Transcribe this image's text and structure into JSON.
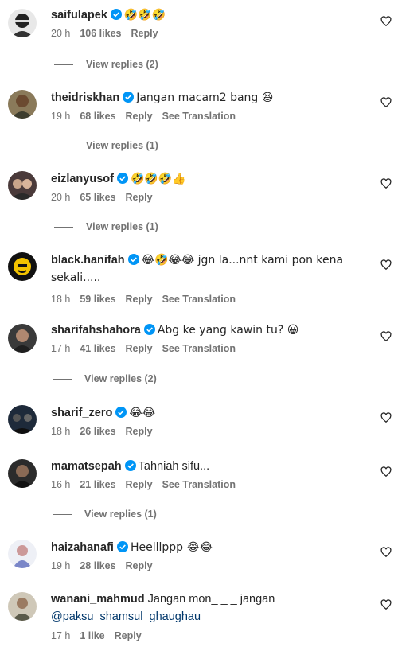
{
  "colors": {
    "text": "#262626",
    "muted": "#737373",
    "link": "#00376b",
    "verified": "#0095f6"
  },
  "comments": [
    {
      "username": "saifulapek",
      "verified": true,
      "text": "🤣🤣🤣",
      "time": "20 h",
      "likes": "106 likes",
      "reply": "Reply",
      "translate": "",
      "view_replies": "View replies (2)"
    },
    {
      "username": "theidriskhan",
      "verified": true,
      "text": "Jangan macam2 bang 😆",
      "time": "19 h",
      "likes": "68 likes",
      "reply": "Reply",
      "translate": "See Translation",
      "view_replies": "View replies (1)"
    },
    {
      "username": "eizlanyusof",
      "verified": true,
      "text": "🤣🤣🤣👍",
      "time": "20 h",
      "likes": "65 likes",
      "reply": "Reply",
      "translate": "",
      "view_replies": "View replies (1)"
    },
    {
      "username": "black.hanifah",
      "verified": true,
      "text": "😂🤣😂😂 jgn la...nnt kami pon kena sekali.....",
      "time": "18 h",
      "likes": "59 likes",
      "reply": "Reply",
      "translate": "See Translation",
      "view_replies": ""
    },
    {
      "username": "sharifahshahora",
      "verified": true,
      "text": "Abg ke yang kawin tu? 😀",
      "time": "17 h",
      "likes": "41 likes",
      "reply": "Reply",
      "translate": "See Translation",
      "view_replies": "View replies (2)"
    },
    {
      "username": "sharif_zero",
      "verified": true,
      "text": "😂😂",
      "time": "18 h",
      "likes": "26 likes",
      "reply": "Reply",
      "translate": "",
      "view_replies": ""
    },
    {
      "username": "mamatsepah",
      "verified": true,
      "text": "Tahniah sifu...",
      "time": "16 h",
      "likes": "21 likes",
      "reply": "Reply",
      "translate": "See Translation",
      "view_replies": "View replies (1)"
    },
    {
      "username": "haizahanafi",
      "verified": true,
      "text": "Heelllppp 😂😂",
      "time": "19 h",
      "likes": "28 likes",
      "reply": "Reply",
      "translate": "",
      "view_replies": ""
    },
    {
      "username": "wanani_mahmud",
      "verified": false,
      "text": "Jangan mon_ _ _ jangan",
      "mention": "@paksu_shamsul_ghaughau",
      "time": "17 h",
      "likes": "1 like",
      "reply": "Reply",
      "translate": "",
      "view_replies": ""
    }
  ]
}
